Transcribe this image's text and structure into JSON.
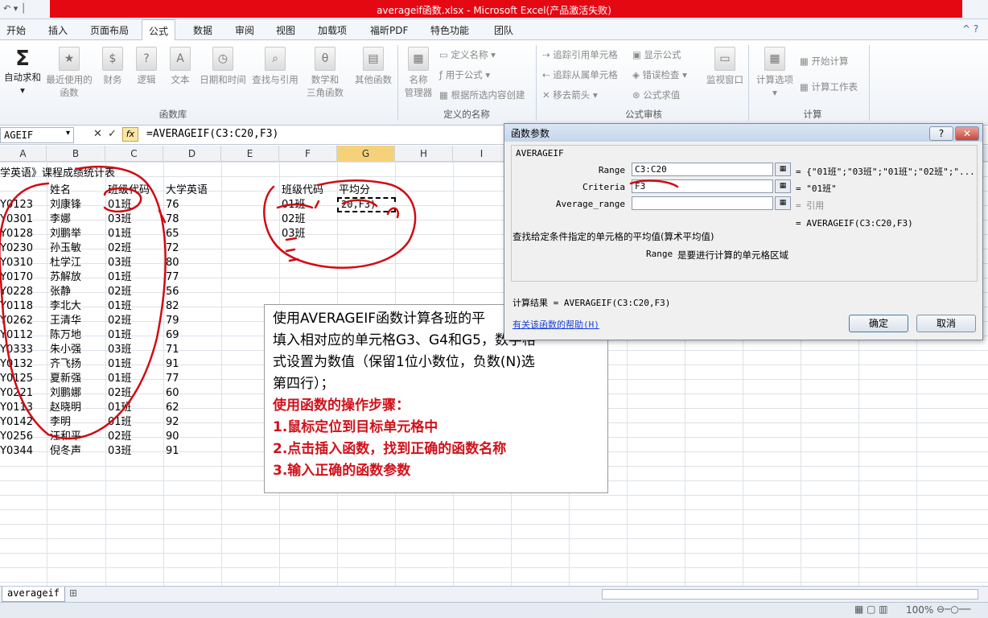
{
  "window": {
    "title": "averageif函数.xlsx - Microsoft Excel(产品激活失败)"
  },
  "tabs": [
    "开始",
    "插入",
    "页面布局",
    "公式",
    "数据",
    "审阅",
    "视图",
    "加载项",
    "福昕PDF",
    "特色功能",
    "团队"
  ],
  "ribbon": {
    "autosum": "自动求和",
    "recent": [
      "最近使用的",
      "函数"
    ],
    "finance": "财务",
    "logic": "逻辑",
    "text": "文本",
    "datetime": "日期和时间",
    "lookup": "查找与引用",
    "math": [
      "数学和",
      "三角函数"
    ],
    "other": "其他函数",
    "group_lib": "函数库",
    "name_mgr": [
      "名称",
      "管理器"
    ],
    "define_name": "定义名称",
    "use_in_formula": "用于公式",
    "create_from_sel": "根据所选内容创建",
    "group_names": "定义的名称",
    "trace_prec": "追踪引用单元格",
    "trace_dep": "追踪从属单元格",
    "remove_arrows": "移去箭头",
    "show_formulas": "显示公式",
    "error_check": "错误检查",
    "eval_formula": "公式求值",
    "watch": "监视窗口",
    "group_audit": "公式审核",
    "calc_options": "计算选项",
    "calc_now": "开始计算",
    "calc_sheet": "计算工作表",
    "group_calc": "计算"
  },
  "formula_bar": {
    "name_box": "AGEIF",
    "fx": "fx",
    "formula": "=AVERAGEIF(C3:C20,F3)"
  },
  "columns": [
    "A",
    "B",
    "C",
    "D",
    "E",
    "F",
    "G",
    "H",
    "I"
  ],
  "sheet": {
    "title": "学英语》课程成绩统计表",
    "headers": [
      "姓名",
      "班级代码",
      "大学英语"
    ],
    "rows": [
      [
        "Y0123",
        "刘康锋",
        "01班",
        "76"
      ],
      [
        "Y0301",
        "李娜",
        "03班",
        "78"
      ],
      [
        "Y0128",
        "刘鹏举",
        "01班",
        "65"
      ],
      [
        "Y0230",
        "孙玉敏",
        "02班",
        "72"
      ],
      [
        "Y0310",
        "杜学江",
        "03班",
        "80"
      ],
      [
        "Y0170",
        "苏解放",
        "01班",
        "77"
      ],
      [
        "Y0228",
        "张静",
        "02班",
        "56"
      ],
      [
        "Y0118",
        "李北大",
        "01班",
        "82"
      ],
      [
        "Y0262",
        "王清华",
        "02班",
        "79"
      ],
      [
        "Y0112",
        "陈万地",
        "01班",
        "69"
      ],
      [
        "Y0333",
        "朱小强",
        "03班",
        "71"
      ],
      [
        "Y0132",
        "齐飞扬",
        "01班",
        "91"
      ],
      [
        "Y0125",
        "夏新强",
        "01班",
        "77"
      ],
      [
        "Y0221",
        "刘鹏娜",
        "02班",
        "60"
      ],
      [
        "Y0113",
        "赵晓明",
        "01班",
        "62"
      ],
      [
        "Y0142",
        "李明",
        "01班",
        "92"
      ],
      [
        "Y0256",
        "汪和平",
        "02班",
        "90"
      ],
      [
        "Y0344",
        "倪冬声",
        "03班",
        "91"
      ]
    ],
    "summary_headers": [
      "班级代码",
      "平均分"
    ],
    "summary_rows": [
      "01班",
      "02班",
      "03班"
    ],
    "editing_cell": "20,F3)"
  },
  "note": {
    "lines": [
      "使用AVERAGEIF函数计算各班的平",
      "填入相对应的单元格G3、G4和G5，数字格",
      "式设置为数值（保留1位小数位，负数(N)选",
      "第四行）；"
    ],
    "red_lines": [
      "使用函数的操作步骤：",
      "1.鼠标定位到目标单元格中",
      "2.点击插入函数，找到正确的函数名称",
      "3.输入正确的函数参数"
    ]
  },
  "dialog": {
    "title": "函数参数",
    "func": "AVERAGEIF",
    "range_label": "Range",
    "range_value": "C3:C20",
    "range_result": "= {\"01班\";\"03班\";\"01班\";\"02班\";\"...",
    "criteria_label": "Criteria",
    "criteria_value": "F3",
    "criteria_result": "= \"01班\"",
    "avg_label": "Average_range",
    "avg_result": "= 引用",
    "formula_result": "= AVERAGEIF(C3:C20,F3)",
    "description": "查找给定条件指定的单元格的平均值(算术平均值)",
    "param_name": "Range",
    "param_desc": "是要进行计算的单元格区域",
    "calc_result": "计算结果 = AVERAGEIF(C3:C20,F3)",
    "help_link": "有关该函数的帮助(H)",
    "ok": "确定",
    "cancel": "取消"
  },
  "sheet_tab": "averageif",
  "status": {
    "zoom": "100%"
  }
}
